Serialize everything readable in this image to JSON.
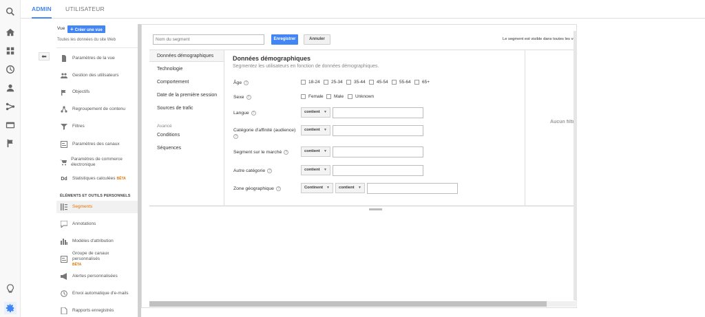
{
  "topbar": {
    "admin_tab": "ADMIN",
    "user_tab": "UTILISATEUR"
  },
  "rail": {
    "icons": [
      "search-icon",
      "home-icon",
      "dashboard-icon",
      "clock-icon",
      "person-icon",
      "acquisition-icon",
      "behavior-icon",
      "flag-icon",
      "lightbulb-icon",
      "gear-icon"
    ]
  },
  "view": {
    "label": "Vue",
    "create_button": "Créer une vue",
    "site_data": "Toutes les données du site Web"
  },
  "nav": {
    "items": [
      {
        "label": "Paramètres de la vue",
        "icon": "document-icon"
      },
      {
        "label": "Gestion des utilisateurs",
        "icon": "users-icon"
      },
      {
        "label": "Objectifs",
        "icon": "flag-icon"
      },
      {
        "label": "Regroupement de contenu",
        "icon": "grouping-icon"
      },
      {
        "label": "Filtres",
        "icon": "filter-icon"
      },
      {
        "label": "Paramètres des canaux",
        "icon": "channel-icon"
      },
      {
        "label": "Paramètres de commerce électronique",
        "icon": "cart-icon"
      },
      {
        "label": "Statistiques calculées",
        "icon": "calc-icon",
        "badge": "BÊTA"
      }
    ],
    "section_title": "ÉLÉMENTS ET OUTILS PERSONNELS",
    "personal_items": [
      {
        "label": "Segments",
        "icon": "segments-icon",
        "active": true
      },
      {
        "label": "Annotations",
        "icon": "annotation-icon"
      },
      {
        "label": "Modèles d'attribution",
        "icon": "bar-chart-icon"
      },
      {
        "label": "Groupe de canaux personnalisés",
        "icon": "channel-group-icon",
        "badge": "BÊTA"
      },
      {
        "label": "Alertes personnalisées",
        "icon": "megaphone-icon"
      },
      {
        "label": "Envoi automatique d'e-mails",
        "icon": "clock-mail-icon"
      },
      {
        "label": "Rapports enregistrés",
        "icon": "report-icon"
      }
    ]
  },
  "segment": {
    "name_placeholder": "Nom du segment",
    "save_label": "Enregistrer",
    "cancel_label": "Annuler",
    "visibility_text": "Le segment est visible dans toutes les vues",
    "categories": [
      "Données démographiques",
      "Technologie",
      "Comportement",
      "Date de la première session",
      "Sources de trafic"
    ],
    "advanced_label": "Avancé",
    "advanced_items": [
      "Conditions",
      "Séquences"
    ],
    "no_filter": "Aucun filtre"
  },
  "demographics": {
    "title": "Données démographiques",
    "subtitle": "Segmentez les utilisateurs en fonction de données démographiques.",
    "age_label": "Âge",
    "age_options": [
      "18-24",
      "25-34",
      "35-44",
      "45-54",
      "55-64",
      "65+"
    ],
    "sex_label": "Sexe",
    "sex_options": [
      "Female",
      "Male",
      "Unknown"
    ],
    "language_label": "Langue",
    "affinity_label": "Catégorie d'affinité (audience)",
    "market_label": "Segment sur le marché",
    "other_label": "Autre catégorie",
    "geo_label": "Zone géographique",
    "contains": "contient",
    "continent": "Continent"
  }
}
